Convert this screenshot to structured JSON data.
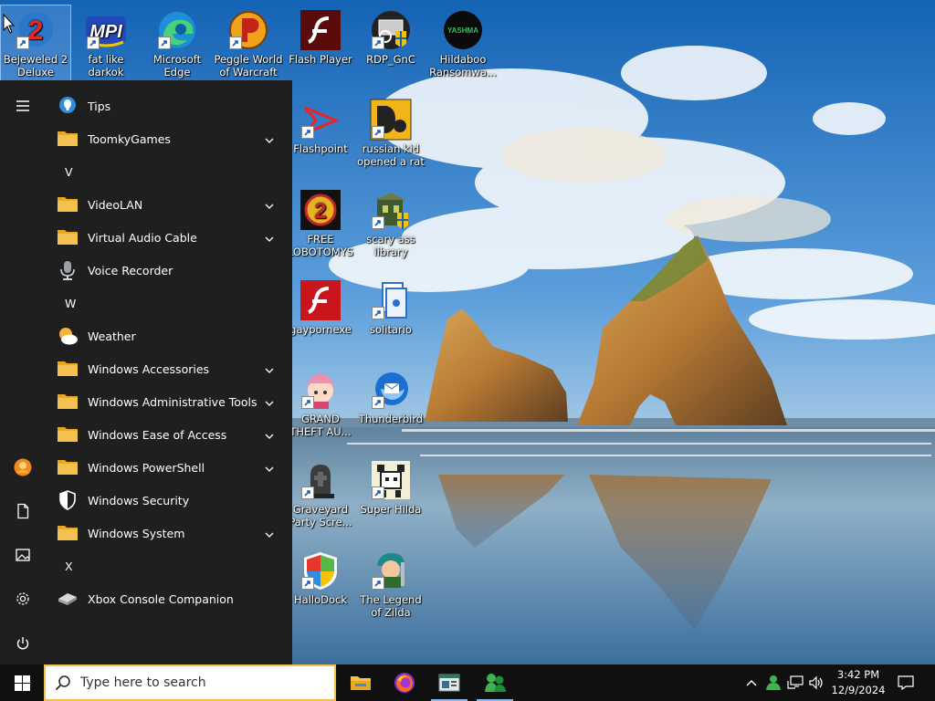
{
  "desktop": {
    "icons": [
      {
        "label": "Bejeweled 2 Deluxe"
      },
      {
        "label": "fat like darkok"
      },
      {
        "label": "Microsoft Edge"
      },
      {
        "label": "Peggle World of Warcraft ..."
      },
      {
        "label": "Flash Player"
      },
      {
        "label": "RDP_GnC"
      },
      {
        "label": "Hildaboo Ransomwa..."
      },
      {
        "label": "Flashpoint"
      },
      {
        "label": "russian kid opened a rat"
      },
      {
        "label": "FREE LOBOTOMYS"
      },
      {
        "label": "scary ass library"
      },
      {
        "label": "gaypornexe"
      },
      {
        "label": "solitario"
      },
      {
        "label": "GRAND THEFT AU..."
      },
      {
        "label": "Thunderbird"
      },
      {
        "label": "Graveyard Party Scre..."
      },
      {
        "label": "Super Hilda"
      },
      {
        "label": "HalloDock"
      },
      {
        "label": "The Legend of Zilda"
      }
    ],
    "icon_badges": {
      "yashma_text": "YASHMA",
      "mpi_text": "MPI",
      "bejeweled_digit": "2",
      "lobotomy_digit": "2"
    }
  },
  "start_menu": {
    "items": [
      {
        "type": "app",
        "label": "Tips",
        "icon": "tips-icon"
      },
      {
        "type": "folder",
        "label": "ToomkyGames"
      },
      {
        "type": "letter",
        "label": "V"
      },
      {
        "type": "folder",
        "label": "VideoLAN"
      },
      {
        "type": "folder",
        "label": "Virtual Audio Cable"
      },
      {
        "type": "app",
        "label": "Voice Recorder",
        "icon": "microphone-icon"
      },
      {
        "type": "letter",
        "label": "W"
      },
      {
        "type": "app",
        "label": "Weather",
        "icon": "weather-icon"
      },
      {
        "type": "folder",
        "label": "Windows Accessories"
      },
      {
        "type": "folder",
        "label": "Windows Administrative Tools"
      },
      {
        "type": "folder",
        "label": "Windows Ease of Access"
      },
      {
        "type": "folder",
        "label": "Windows PowerShell"
      },
      {
        "type": "app",
        "label": "Windows Security",
        "icon": "shield-icon"
      },
      {
        "type": "folder",
        "label": "Windows System"
      },
      {
        "type": "letter",
        "label": "X"
      },
      {
        "type": "app",
        "label": "Xbox Console Companion",
        "icon": "xbox-icon"
      }
    ],
    "rail": [
      "hamburger-icon",
      "user-avatar",
      "documents-icon",
      "pictures-icon",
      "settings-icon",
      "power-icon"
    ]
  },
  "taskbar": {
    "search_placeholder": "Type here to search",
    "pinned": [
      "file-explorer-icon",
      "firefox-icon",
      "app-window-icon",
      "messenger-icon"
    ],
    "tray": [
      "chevron-up-icon",
      "people-icon",
      "network-icon",
      "volume-icon"
    ],
    "time": "3:42 PM",
    "date": "12/9/2024"
  },
  "colors": {
    "start_bg": "#1f1f1f",
    "taskbar_bg": "#101010",
    "folder": "#f2c14e",
    "search_border": "#f2c14e",
    "accent": "#0078d7"
  }
}
